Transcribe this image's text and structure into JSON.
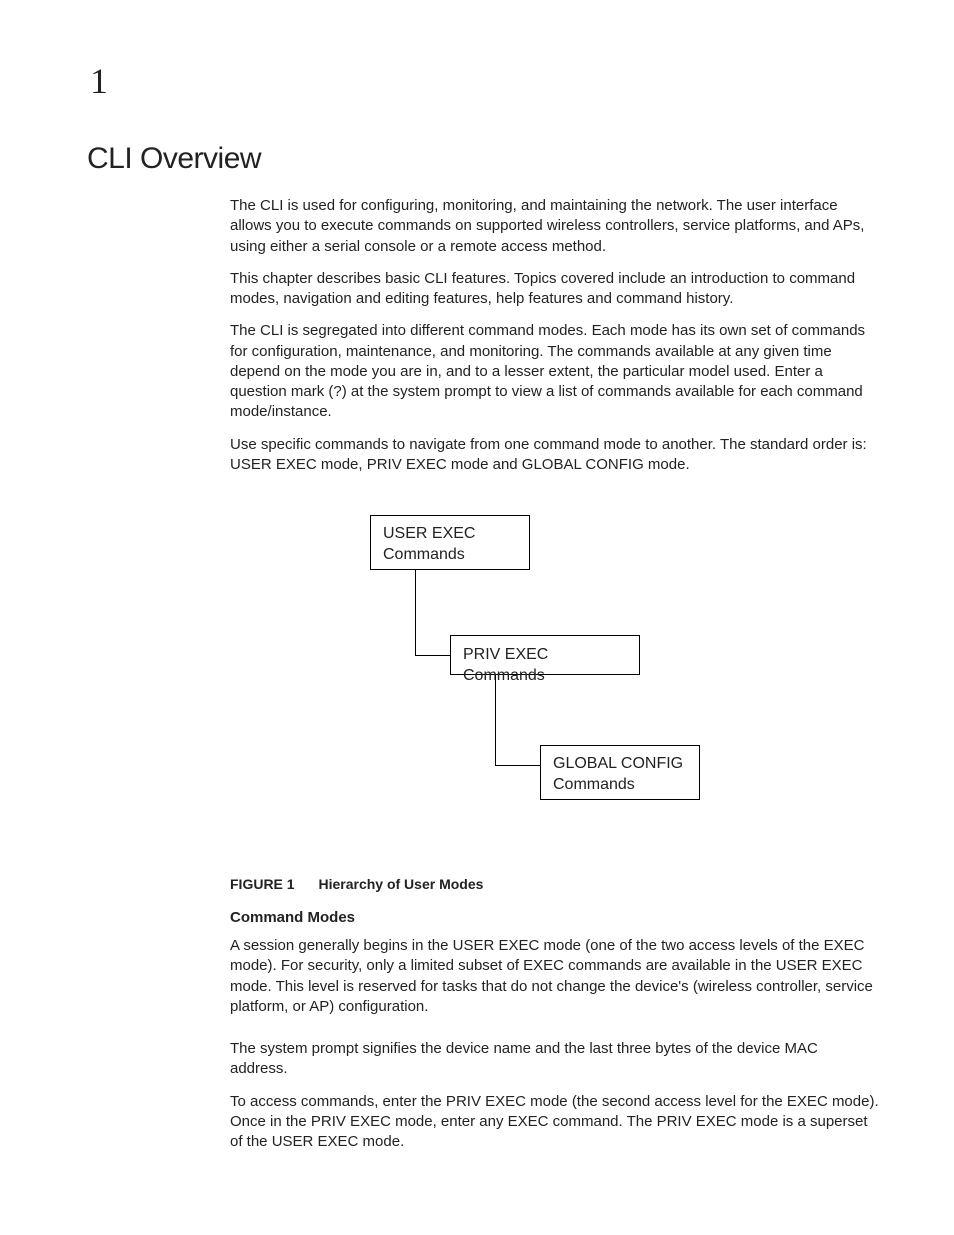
{
  "chapter_number": "1",
  "title": "CLI Overview",
  "paragraphs": {
    "p1": "The CLI is used for configuring, monitoring, and maintaining the network. The user interface allows you to execute commands on supported wireless controllers, service platforms, and APs, using either a serial console or a remote access method.",
    "p2": "This chapter describes basic CLI features. Topics covered include an introduction to command modes, navigation and editing features, help features and command history.",
    "p3": "The CLI is segregated into different command modes. Each mode has its own set of commands for configuration, maintenance, and monitoring. The commands available at any given time depend on the mode you are in, and to a lesser extent, the particular model used. Enter a question mark (?) at the system prompt to view a list of commands available for each command mode/instance.",
    "p4": "Use specific commands to navigate from one command mode to another. The standard order is: USER EXEC mode, PRIV EXEC mode and GLOBAL CONFIG mode."
  },
  "diagram": {
    "box1_line1": "USER EXEC",
    "box1_line2": "Commands",
    "box2": "PRIV EXEC Commands",
    "box3_line1": "GLOBAL CONFIG",
    "box3_line2": "Commands"
  },
  "figure": {
    "label": "FIGURE 1",
    "caption": "Hierarchy of User Modes"
  },
  "subheading": "Command Modes",
  "paragraphs2": {
    "p5": "A session generally begins in the USER EXEC mode (one of the two access levels of the EXEC mode). For security, only a limited subset of EXEC commands are available in the USER EXEC mode. This level is reserved for tasks that do not change the device's (wireless controller, service platform, or AP) configuration.",
    "p6": "The system prompt signifies the device name and the last three bytes of the device MAC address.",
    "p7": "To access commands, enter the PRIV EXEC mode (the second access level for the EXEC mode). Once in the PRIV EXEC mode, enter any EXEC command. The PRIV EXEC mode is a superset of the USER EXEC mode."
  }
}
